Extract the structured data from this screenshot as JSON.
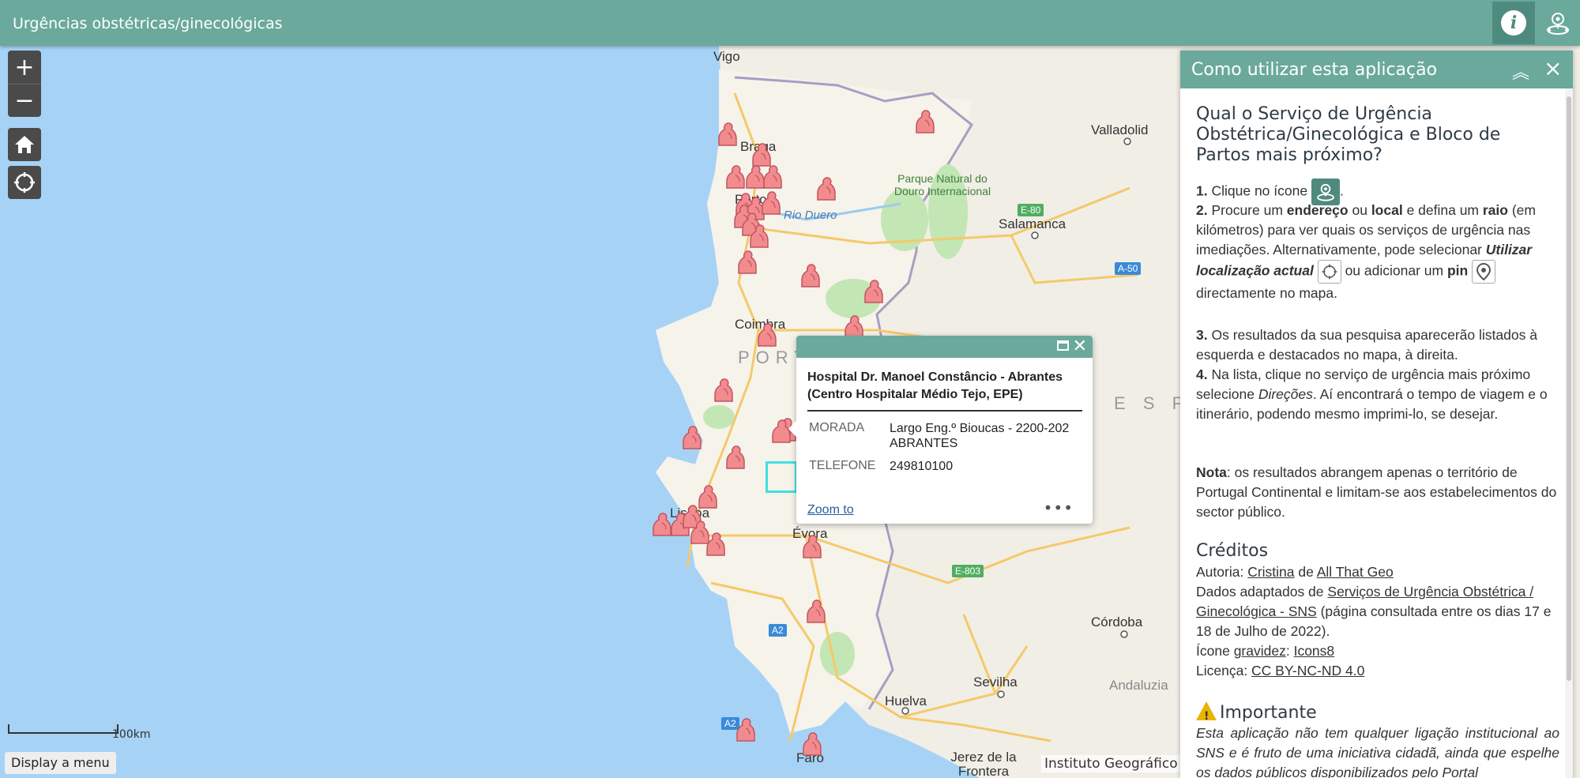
{
  "header": {
    "title": "Urgências obstétricas/ginecológicas",
    "info_icon": "info-icon",
    "locate_icon": "nearby-location-icon"
  },
  "map": {
    "labels": {
      "vigo": "Vigo",
      "braga": "Braga",
      "porto": "Porto",
      "rio_douro": "Rio Duero",
      "valladolid": "Valladolid",
      "salamanca": "Salamanca",
      "parque": "Parque Natural do Douro Internacional",
      "coimbra": "Coimbra",
      "portugal": "PORT",
      "espana": "E S P",
      "lisboa": "Lisboa",
      "evora": "Évora",
      "faro": "Faro",
      "cordoba": "Córdoba",
      "sevilha": "Sevilha",
      "huelva": "Huelva",
      "jerez": "Jerez de la Frontera",
      "andaluzia": "Andaluzia"
    },
    "roads": {
      "e80": "E-80",
      "a50": "A-50",
      "e803": "E-803",
      "a2_1": "A2",
      "a2_2": "A2"
    },
    "controls": {
      "zoom_in": "+",
      "zoom_out": "−"
    },
    "scale_label": "100km",
    "display_menu": "Display a menu",
    "attribution": "Instituto Geográfico"
  },
  "popup": {
    "title": "Hospital Dr. Manoel Constâncio - Abrantes (Centro Hospitalar Médio Tejo, EPE)",
    "fields": [
      {
        "key": "MORADA",
        "value": "Largo Eng.º Bioucas - 2200-202 ABRANTES"
      },
      {
        "key": "TELEFONE",
        "value": "249810100"
      }
    ],
    "zoom_to": "Zoom to",
    "more": "•••"
  },
  "panel": {
    "title": "Como utilizar esta aplicação",
    "question": "Qual o Serviço de Urgência Obstétrica/Ginecológica e Bloco de Partos mais próximo?",
    "step1_a": "1.",
    "step1_b": " Clique no ícone ",
    "step1_c": ".",
    "step2_num": "2.",
    "step2_a": " Procure um ",
    "step2_endereco": "endereço",
    "step2_b": " ou ",
    "step2_local": "local",
    "step2_c": " e defina um ",
    "step2_raio": "raio",
    "step2_d": " (em kilómetros) para ver quais os serviços de urgência nas imediações. Alternativamente, pode selecionar ",
    "step2_util": "Utilizar localização actual",
    "step2_e": " ou adicionar um ",
    "step2_pin": "pin",
    "step2_f": " directamente no mapa.",
    "step3_num": "3.",
    "step3": " Os resultados da sua pesquisa aparecerão listados à esquerda e destacados no mapa, à direita.",
    "step4_num": "4.",
    "step4_a": " Na lista, clique no serviço de urgência mais próximo selecione ",
    "step4_dir": "Direções",
    "step4_b": ". Aí encontrará o tempo de viagem e o itinerário, podendo mesmo imprimi-lo, se desejar.",
    "nota_label": "Nota",
    "nota": ": os resultados abrangem apenas o território de Portugal Continental e limitam-se aos estabelecimentos do sector público.",
    "creditos": "Créditos",
    "autoria": "Autoria: ",
    "cristina": "Cristina",
    "de": " de ",
    "allthatgeo": "All That Geo",
    "dados": "Dados adaptados de ",
    "servicos_link": "Serviços de Urgência Obstétrica / Ginecológica - SNS",
    "dados_b": " (página consultada entre os dias 17 e 18 de Julho de 2022).",
    "icone": "Ícone ",
    "gravidez": "gravidez",
    "colon": ": ",
    "icons8": "Icons8",
    "licenca": "Licença: ",
    "cc": "CC BY-NC-ND 4.0",
    "importante": "Importante",
    "important_text": "Esta aplicação não tem qualquer ligação institucional ao SNS e é fruto de uma iniciativa cidadã, ainda que espelhe os dados públicos disponibilizados pelo Portal"
  }
}
